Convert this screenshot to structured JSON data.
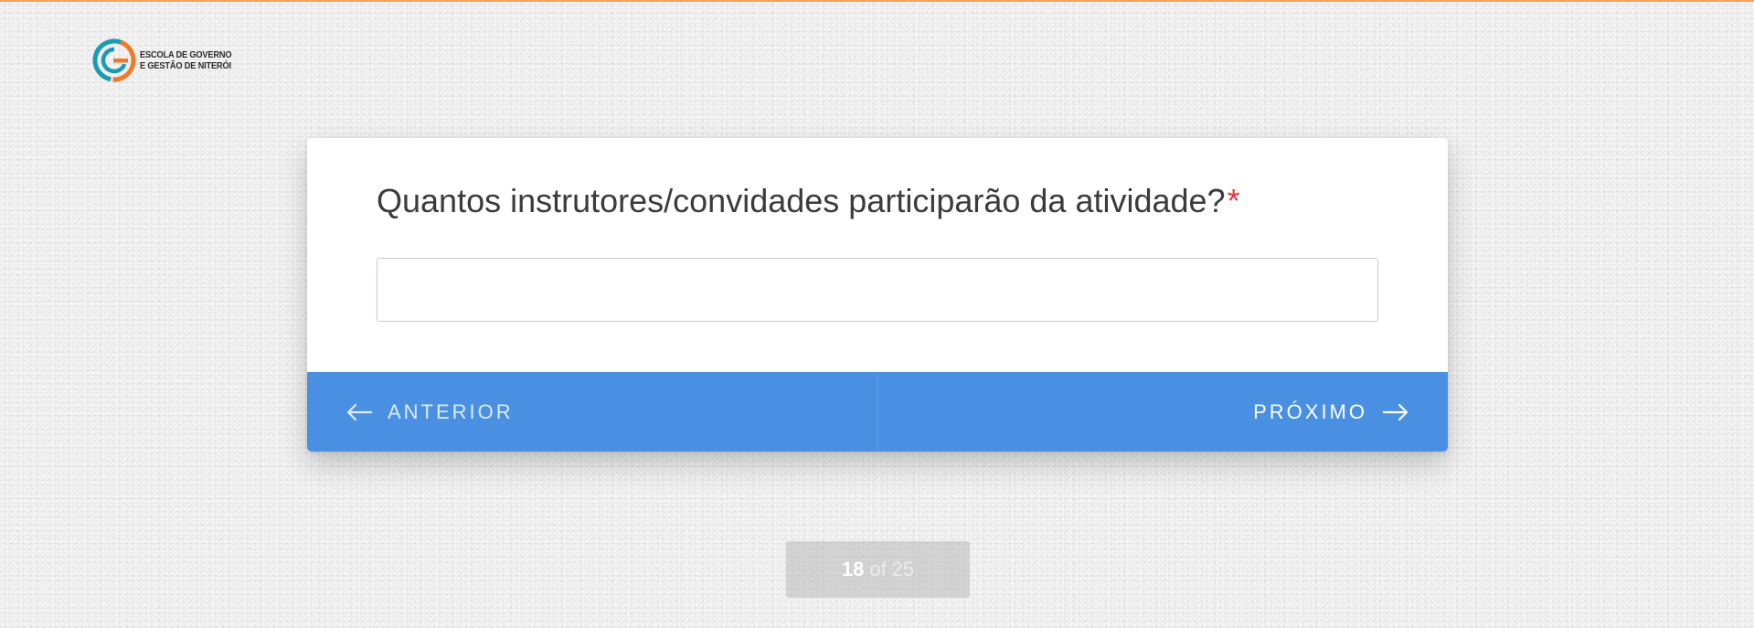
{
  "logo": {
    "line1": "ESCOLA DE GOVERNO",
    "line2": "E GESTÃO DE NITERÓI",
    "colors": {
      "teal": "#1a9bb0",
      "orange": "#f07a2c"
    }
  },
  "question": {
    "text": "Quantos instrutores/convidades participarão da atividade?",
    "required_mark": "*"
  },
  "answer": {
    "value": "",
    "placeholder": ""
  },
  "navigation": {
    "prev_label": "ANTERIOR",
    "next_label": "PRÓXIMO",
    "prev_icon": "arrow-left-icon",
    "next_icon": "arrow-right-icon",
    "bar_color": "#4a90e2"
  },
  "progress": {
    "current": "18",
    "separator": "of",
    "total": "25"
  },
  "colors": {
    "accent_top": "#f2a15e",
    "required": "#e8363f"
  }
}
